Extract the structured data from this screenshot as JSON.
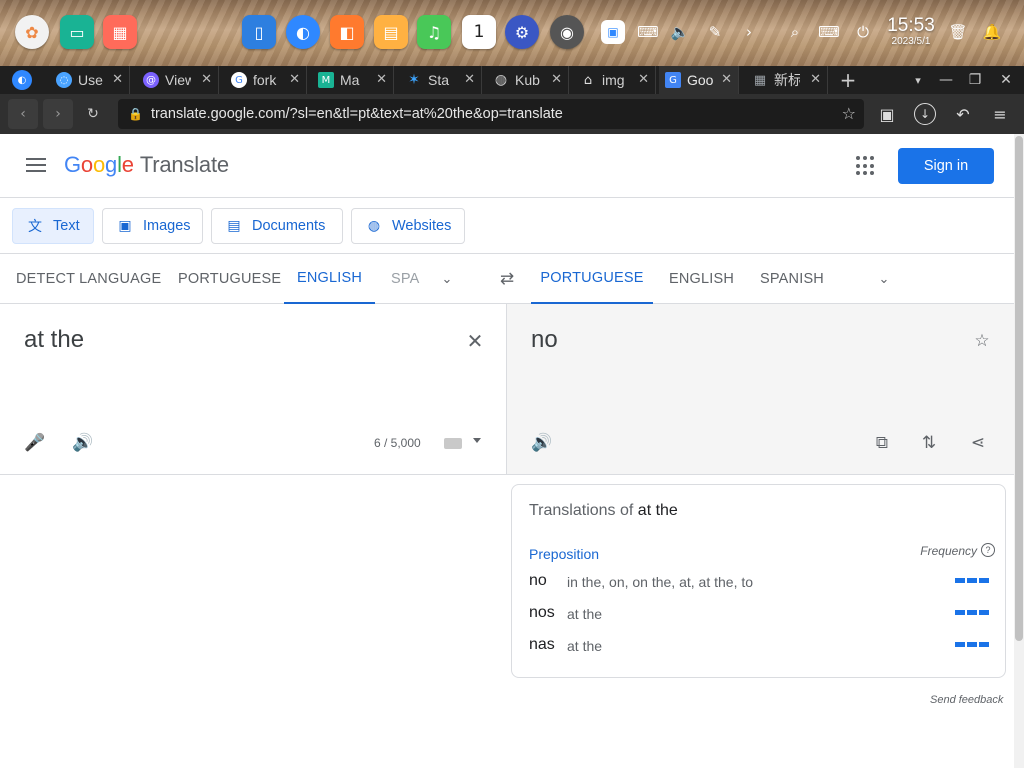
{
  "taskbar": {
    "apps": [
      {
        "icon": "launcher-icon",
        "color": "#f2f2f2"
      },
      {
        "icon": "terminal-icon",
        "color": "#19b394"
      },
      {
        "icon": "app-store-icon",
        "color": "#ff6b5a"
      },
      {
        "icon": "file-manager-icon",
        "color": "#2d7fe0"
      },
      {
        "icon": "browser-icon",
        "color": "#2f88ff"
      },
      {
        "icon": "store-bag-icon",
        "color": "#ff7a2e"
      },
      {
        "icon": "photos-icon",
        "color": "#ffb142"
      },
      {
        "icon": "music-icon",
        "color": "#49c858"
      },
      {
        "icon": "calendar-icon",
        "color": "#ffffff"
      },
      {
        "icon": "settings-icon",
        "color": "#3a57c4"
      },
      {
        "icon": "disk-icon",
        "color": "#555555"
      }
    ],
    "calendar_day": "1",
    "clock_time": "15:53",
    "clock_date": "2023/5/1"
  },
  "tabs": [
    {
      "title": "",
      "favicon_color": "#2f88ff",
      "active": false
    },
    {
      "title": "Use",
      "favicon_color": "#4aa3ff",
      "active": false
    },
    {
      "title": "View",
      "favicon_color": "#7b61ff",
      "active": false
    },
    {
      "title": "fork",
      "favicon_color": "#ffffff",
      "active": false
    },
    {
      "title": "Ma",
      "favicon_color": "#19b394",
      "active": false
    },
    {
      "title": "Sta",
      "favicon_color": "#3da5ff",
      "active": false
    },
    {
      "title": "Kub",
      "favicon_color": "#888888",
      "active": false
    },
    {
      "title": "img",
      "favicon_color": "#cccccc",
      "active": false
    },
    {
      "title": "Goo",
      "favicon_color": "#4285f4",
      "active": true
    },
    {
      "title": "新标",
      "favicon_color": "#9aa0a6",
      "active": false
    }
  ],
  "address_bar": {
    "url": "translate.google.com/?sl=en&tl=pt&text=at%20the&op=translate"
  },
  "header": {
    "logo_letters": [
      "G",
      "o",
      "o",
      "g",
      "l",
      "e"
    ],
    "product": "Translate",
    "signin_label": "Sign in"
  },
  "modes": [
    {
      "label": "Text",
      "icon": "text-translate-icon",
      "active": true
    },
    {
      "label": "Images",
      "icon": "image-icon",
      "active": false
    },
    {
      "label": "Documents",
      "icon": "document-icon",
      "active": false
    },
    {
      "label": "Websites",
      "icon": "globe-icon",
      "active": false
    }
  ],
  "source_langs": [
    "DETECT LANGUAGE",
    "PORTUGUESE",
    "ENGLISH",
    "SPA"
  ],
  "target_langs": [
    "PORTUGUESE",
    "ENGLISH",
    "SPANISH"
  ],
  "source": {
    "text": "at the",
    "char_count": "6 / 5,000"
  },
  "target": {
    "text": "no"
  },
  "dictionary": {
    "title_prefix": "Translations of",
    "title_term": "at the",
    "pos": "Preposition",
    "frequency_label": "Frequency",
    "entries": [
      {
        "word": "no",
        "synonyms": "in the, on, on the, at, at the, to",
        "frequency": 3
      },
      {
        "word": "nos",
        "synonyms": "at the",
        "frequency": 3
      },
      {
        "word": "nas",
        "synonyms": "at the",
        "frequency": 3
      }
    ]
  },
  "send_feedback": "Send feedback",
  "colors": {
    "accent": "#1a73e8",
    "active_text": "#1967d2"
  }
}
